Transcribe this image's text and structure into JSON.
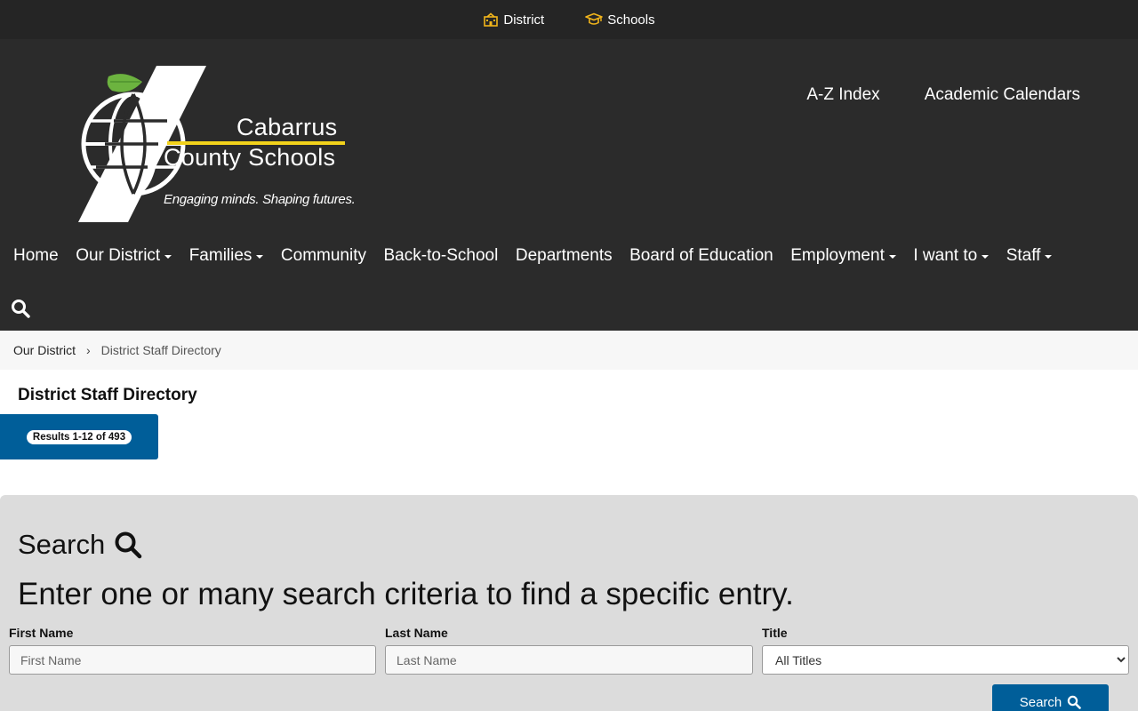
{
  "topbar": {
    "district_label": "District",
    "schools_label": "Schools",
    "icon_color": "#f2b51b"
  },
  "logo": {
    "line1": "Cabarrus",
    "line2": "County Schools",
    "tagline": "Engaging minds. Shaping futures.",
    "leaf_color": "#6cb33f",
    "accent_color": "#f2d21b"
  },
  "utility_links": {
    "az_index": "A-Z Index",
    "calendars": "Academic Calendars"
  },
  "nav": {
    "items": [
      {
        "label": "Home",
        "dropdown": false
      },
      {
        "label": "Our District",
        "dropdown": true
      },
      {
        "label": "Families",
        "dropdown": true
      },
      {
        "label": "Community",
        "dropdown": false
      },
      {
        "label": "Back-to-School",
        "dropdown": false
      },
      {
        "label": "Departments",
        "dropdown": false
      },
      {
        "label": "Board of Education",
        "dropdown": false
      },
      {
        "label": "Employment",
        "dropdown": true
      },
      {
        "label": "I want to",
        "dropdown": true
      },
      {
        "label": "Staff",
        "dropdown": true
      }
    ]
  },
  "breadcrumb": {
    "parent": "Our District",
    "current": "District Staff Directory"
  },
  "page": {
    "title": "District Staff Directory",
    "results": "Results 1-12 of 493"
  },
  "search": {
    "heading": "Search",
    "subheading": "Enter one or many search criteria to find a specific entry.",
    "first_name_label": "First Name",
    "first_name_placeholder": "First Name",
    "last_name_label": "Last Name",
    "last_name_placeholder": "Last Name",
    "title_label": "Title",
    "title_selected": "All Titles",
    "button_label": "Search"
  },
  "colors": {
    "header_bg": "#2b2b2b",
    "topbar_bg": "#252525",
    "primary_blue": "#005e99",
    "panel_bg": "#dcdcdc"
  }
}
